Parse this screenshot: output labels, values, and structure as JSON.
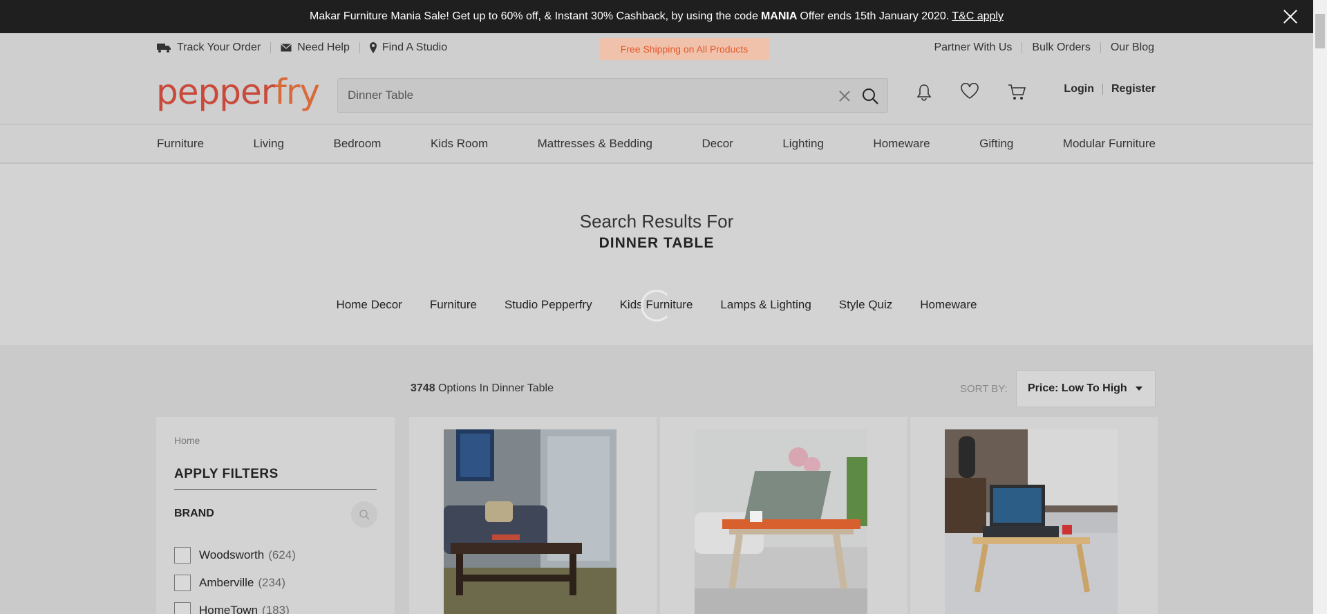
{
  "promo": {
    "text_before": "Makar Furniture Mania Sale! Get up to 60% off, & Instant 30% Cashback, by using the code",
    "code": "MANIA",
    "text_after": "Offer ends 15th January 2020.",
    "link": "T&C apply"
  },
  "utility": {
    "track": "Track Your Order",
    "help": "Need Help",
    "studio": "Find A Studio",
    "shipping": "Free Shipping on All Products",
    "partner": "Partner With Us",
    "bulk": "Bulk Orders",
    "blog": "Our Blog"
  },
  "header": {
    "logo_a": "pepper",
    "logo_b": "fry",
    "search_value": "Dinner Table",
    "login": "Login",
    "register": "Register"
  },
  "nav": [
    "Furniture",
    "Living",
    "Bedroom",
    "Kids Room",
    "Mattresses & Bedding",
    "Decor",
    "Lighting",
    "Homeware",
    "Gifting",
    "Modular Furniture"
  ],
  "results": {
    "title": "Search Results For",
    "query": "DINNER TABLE",
    "categories": [
      "Home Decor",
      "Furniture",
      "Studio Pepperfry",
      "Kids Furniture",
      "Lamps & Lighting",
      "Style Quiz",
      "Homeware"
    ]
  },
  "listing": {
    "count": "3748",
    "count_suffix": "Options In Dinner Table",
    "sort_label": "SORT BY:",
    "sort_value": "Price: Low To High"
  },
  "filters": {
    "breadcrumb": "Home",
    "heading": "APPLY FILTERS",
    "brand_label": "BRAND",
    "brands": [
      {
        "name": "Woodsworth",
        "count": "(624)"
      },
      {
        "name": "Amberville",
        "count": "(234)"
      },
      {
        "name": "HomeTown",
        "count": "(183)"
      }
    ]
  },
  "colors": {
    "brand_red": "#c94a3a",
    "shipping_text": "#e0582a",
    "promo_bg": "#1f1f1f"
  }
}
